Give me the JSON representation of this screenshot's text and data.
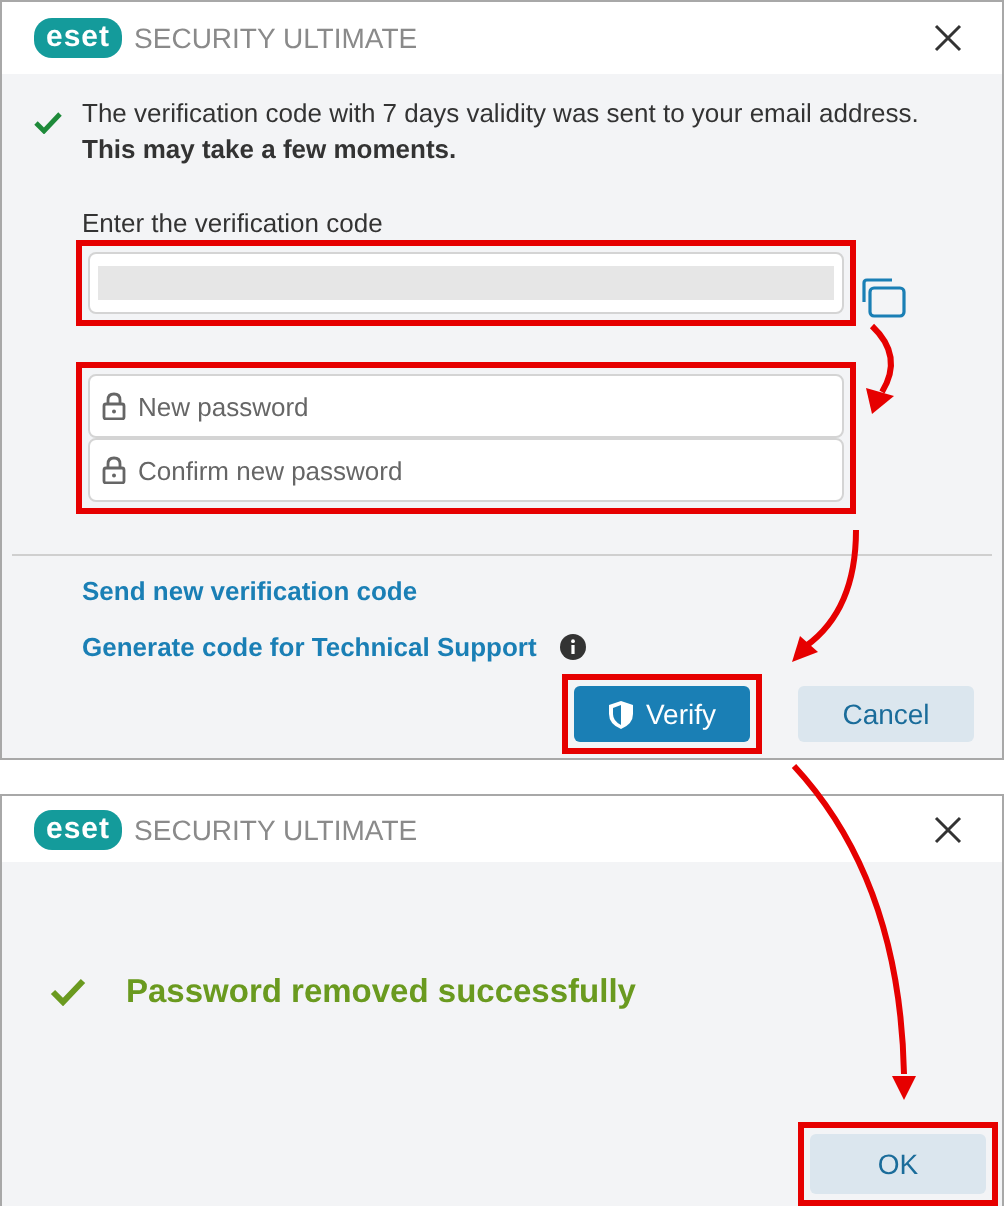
{
  "verify_dialog": {
    "brand": "eset",
    "title": "SECURITY ULTIMATE",
    "notice": {
      "line": "The verification code with 7 days validity was sent to your email address.",
      "note": "This may take a few moments."
    },
    "code_field": {
      "label": "Enter the verification code",
      "kind": "redacted",
      "highlighted": true
    },
    "password_fields": {
      "highlighted": true,
      "fields": [
        {
          "placeholder": "New password"
        },
        {
          "placeholder": "Confirm new password"
        }
      ]
    },
    "links": [
      {
        "label": "Send new verification code",
        "info": false
      },
      {
        "label": "Generate code for Technical Support",
        "info": true
      }
    ],
    "buttons": [
      {
        "label": "Verify",
        "kind": "primary",
        "highlighted": true
      },
      {
        "label": "Cancel",
        "kind": "secondary",
        "highlighted": false
      }
    ]
  },
  "success_dialog": {
    "brand": "eset",
    "title": "SECURITY ULTIMATE",
    "message": "Password removed successfully",
    "buttons": [
      {
        "label": "OK",
        "kind": "secondary",
        "highlighted": true
      }
    ]
  }
}
